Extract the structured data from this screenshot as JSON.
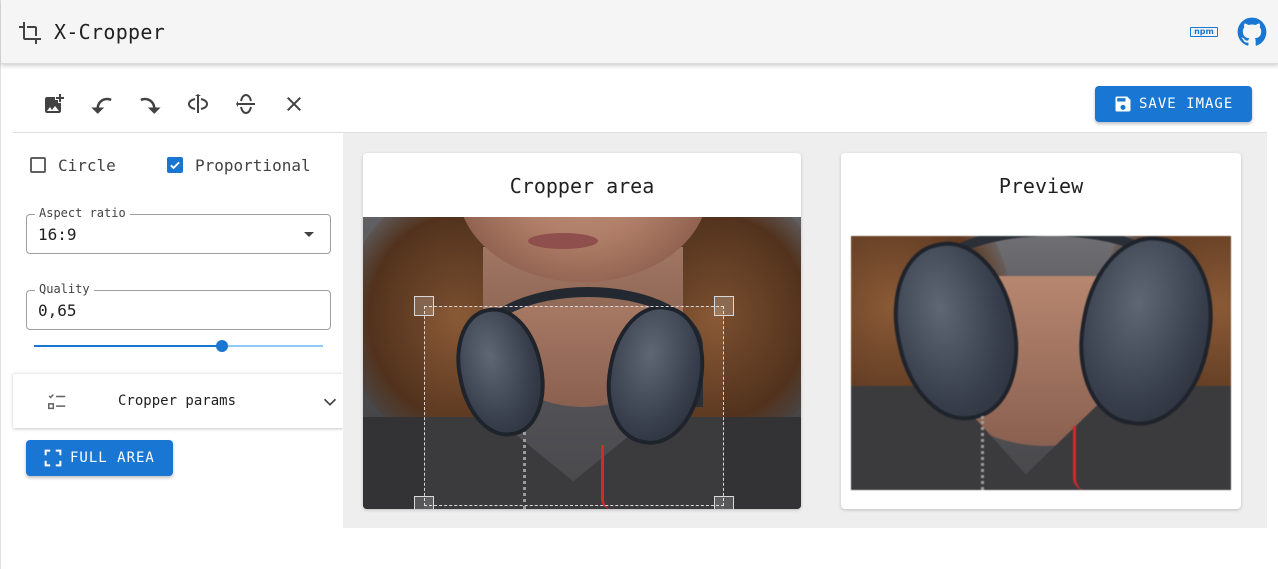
{
  "app": {
    "title": "X-Cropper",
    "npm_label": "npm"
  },
  "header": {
    "logo_icon": "crop-icon",
    "npm_icon": "npm-icon",
    "github_icon": "github-icon"
  },
  "toolbar": {
    "tools": [
      {
        "name": "add-image",
        "icon": "add-photo-icon"
      },
      {
        "name": "rotate-left",
        "icon": "rotate-left-icon"
      },
      {
        "name": "rotate-right",
        "icon": "rotate-right-icon"
      },
      {
        "name": "flip-horizontal",
        "icon": "flip-horizontal-icon"
      },
      {
        "name": "flip-vertical",
        "icon": "flip-vertical-icon"
      },
      {
        "name": "clear",
        "icon": "close-icon"
      }
    ],
    "save_label": "SAVE IMAGE",
    "save_icon": "save-icon"
  },
  "options": {
    "circle": {
      "label": "Circle",
      "checked": false
    },
    "proportional": {
      "label": "Proportional",
      "checked": true
    },
    "aspect_ratio": {
      "label": "Aspect ratio",
      "value": "16:9"
    },
    "quality": {
      "label": "Quality",
      "value": "0,65",
      "slider_value": 0.65
    },
    "params": {
      "label": "Cropper params",
      "icon": "checklist-icon",
      "chevron": "chevron-down-icon"
    },
    "full_area": {
      "label": "FULL AREA",
      "icon": "fullscreen-icon"
    }
  },
  "cropper": {
    "title": "Cropper area"
  },
  "preview": {
    "title": "Preview"
  },
  "colors": {
    "primary": "#1976d2",
    "rail": "#90caf9",
    "header_bg": "#f5f5f5",
    "main_bg": "#eeeeee"
  }
}
